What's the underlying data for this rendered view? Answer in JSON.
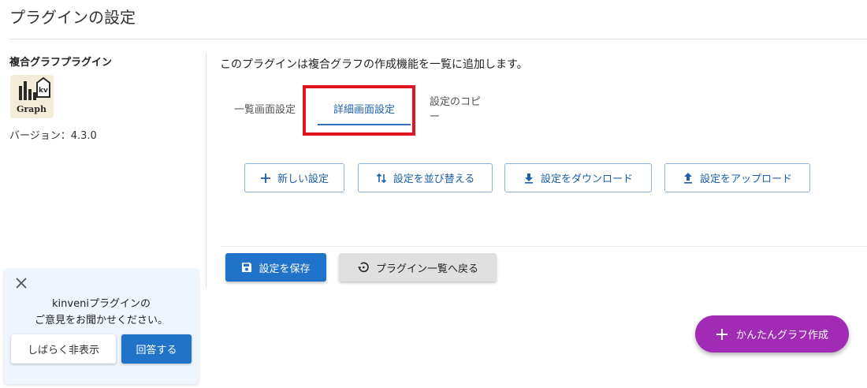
{
  "page": {
    "title": "プラグインの設定"
  },
  "plugin": {
    "name": "複合グラフプラグイン",
    "logo": {
      "icon": "graph-logo-icon",
      "badge_text": "kv",
      "text": "Graph"
    },
    "version": "バージョン：4.3.0"
  },
  "main": {
    "description": "このプラグインは複合グラフの作成機能を一覧に追加します。",
    "tabs": [
      {
        "label": "一覧画面設定",
        "active": false
      },
      {
        "label": "詳細画面設定",
        "active": true
      },
      {
        "label": "設定のコピー",
        "active": false
      }
    ],
    "actions": {
      "new": {
        "label": "新しい設定",
        "icon": "plus-icon"
      },
      "sort": {
        "label": "設定を並び替える",
        "icon": "sort-arrows-icon"
      },
      "download": {
        "label": "設定をダウンロード",
        "icon": "download-icon"
      },
      "upload": {
        "label": "設定をアップロード",
        "icon": "upload-icon"
      }
    },
    "save_label": "設定を保存",
    "back_label": "プラグイン一覧へ戻る"
  },
  "feedback": {
    "line1": "kinveniプラグインの",
    "line2": "ご意見をお聞かせください。",
    "hide_label": "しばらく非表示",
    "answer_label": "回答する"
  },
  "fab": {
    "label": "かんたんグラフ作成",
    "icon": "plus-icon"
  },
  "colors": {
    "primary": "#1f73c9",
    "fab": "#a12bb4",
    "highlight": "#e0151f",
    "feedback_bg": "#eef5fd"
  }
}
